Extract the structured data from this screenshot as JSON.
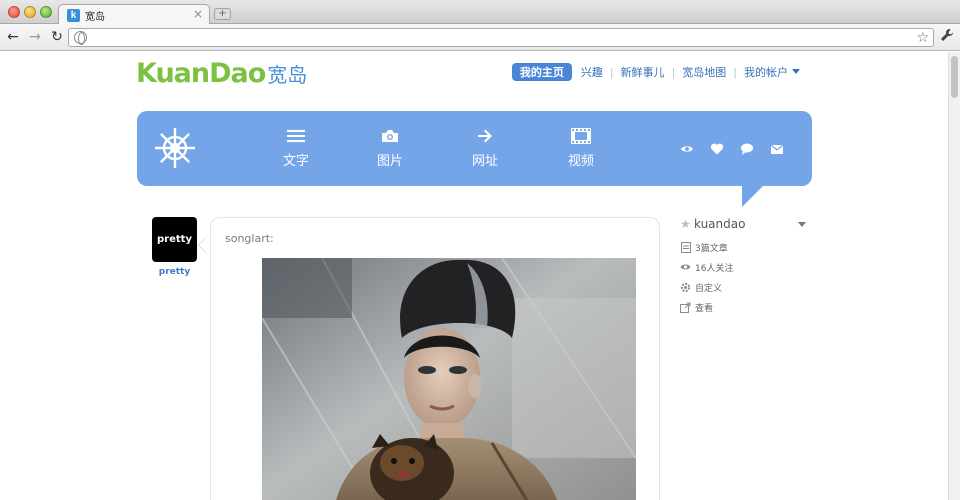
{
  "browser": {
    "tab_title": "宽岛",
    "tab_favicon_letter": "k",
    "tab_close": "×",
    "new_tab": "+",
    "address": ""
  },
  "header": {
    "logo_en": "KuanDao",
    "logo_cn": "宽岛",
    "nav": [
      {
        "label": "我的主页",
        "active": true
      },
      {
        "label": "兴趣"
      },
      {
        "label": "新鲜事儿"
      },
      {
        "label": "宽岛地图"
      },
      {
        "label": "我的帐户",
        "dropdown": true
      }
    ]
  },
  "dashboard": {
    "color": "#75a5e9",
    "items": [
      {
        "label": "文字",
        "icon": "text-lines-icon"
      },
      {
        "label": "图片",
        "icon": "camera-icon"
      },
      {
        "label": "网址",
        "icon": "arrow-right-icon"
      },
      {
        "label": "视频",
        "icon": "film-icon"
      }
    ],
    "mini_icons": [
      "eye-icon",
      "heart-icon",
      "speech-bubble-icon",
      "envelope-icon"
    ]
  },
  "avatar": {
    "text": "pretty",
    "name": "pretty"
  },
  "post": {
    "author": "songlart:"
  },
  "sidebar": {
    "username": "kuandao",
    "rows": [
      {
        "label": "3篇文章",
        "icon": "document-icon"
      },
      {
        "label": "16人关注",
        "icon": "eye-icon"
      },
      {
        "label": "自定义",
        "icon": "gear-icon"
      },
      {
        "label": "查看",
        "icon": "external-link-icon"
      }
    ]
  }
}
